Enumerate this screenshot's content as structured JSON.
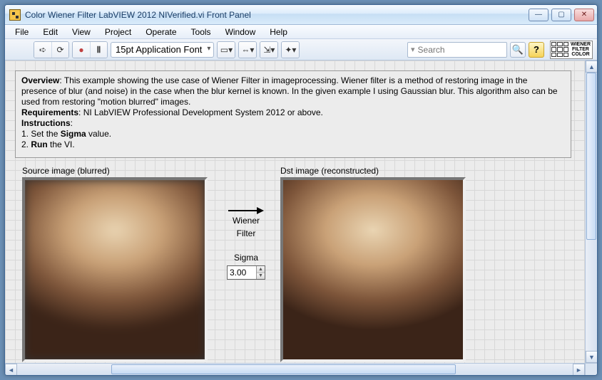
{
  "window": {
    "title": "Color Wiener Filter LabVIEW 2012 NIVerified.vi Front Panel"
  },
  "menus": [
    "File",
    "Edit",
    "View",
    "Project",
    "Operate",
    "Tools",
    "Window",
    "Help"
  ],
  "toolbar": {
    "font_label": "15pt Application Font",
    "search_placeholder": "Search"
  },
  "logo_text": "WIENER\nFILTER\nCOLOR",
  "overview": {
    "heading_overview": "Overview",
    "overview_text": ": This example showing the use case of Wiener Filter in imageprocessing. Wiener filter is a method of restoring image in the presence of blur (and noise) in the case when the blur kernel is known. In the given example I using Gaussian blur. This algorithm also can be used from restoring \"motion blurred\" images.",
    "heading_requirements": "Requirements",
    "requirements_text": ": NI LabVIEW Professional Development System 2012 or above.",
    "heading_instructions": "Instructions",
    "instructions_colon": ":",
    "step1_prefix": "1. Set the ",
    "step1_bold": "Sigma",
    "step1_suffix": " value.",
    "step2_prefix": "2. ",
    "step2_bold": "Run",
    "step2_suffix": " the VI."
  },
  "images": {
    "src_label": "Source image (blurred)",
    "dst_label": "Dst image (reconstructed)"
  },
  "mid": {
    "line1": "Wiener",
    "line2": "Filter",
    "sigma_label": "Sigma",
    "sigma_value": "3.00"
  }
}
